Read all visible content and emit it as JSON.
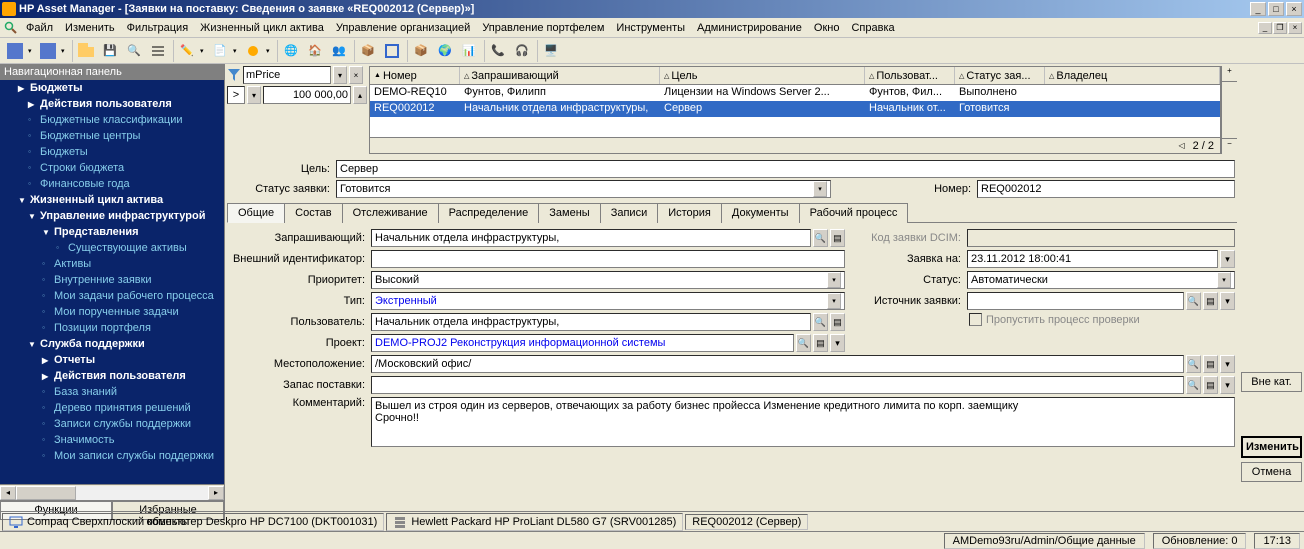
{
  "title": "HP Asset Manager - [Заявки на поставку: Сведения о заявке «REQ002012 (Сервер)»]",
  "menu": [
    "Файл",
    "Изменить",
    "Фильтрация",
    "Жизненный цикл актива",
    "Управление организацией",
    "Управление портфелем",
    "Инструменты",
    "Администрирование",
    "Окно",
    "Справка"
  ],
  "nav": {
    "header": "Навигационная панель",
    "tree": [
      {
        "l": 0,
        "t": "Бюджеты",
        "b": 1,
        "a": "▶"
      },
      {
        "l": 1,
        "t": "Действия пользователя",
        "b": 1,
        "a": "▶"
      },
      {
        "l": 1,
        "t": "Бюджетные классификации",
        "c": 1
      },
      {
        "l": 1,
        "t": "Бюджетные центры",
        "c": 1
      },
      {
        "l": 1,
        "t": "Бюджеты",
        "c": 1
      },
      {
        "l": 1,
        "t": "Строки бюджета",
        "c": 1
      },
      {
        "l": 1,
        "t": "Финансовые года",
        "c": 1
      },
      {
        "l": 0,
        "t": "Жизненный цикл актива",
        "b": 1,
        "a": "▼"
      },
      {
        "l": 1,
        "t": "Управление инфраструктурой",
        "b": 1,
        "a": "▼"
      },
      {
        "l": 2,
        "t": "Представления",
        "b": 1,
        "a": "▼"
      },
      {
        "l": 3,
        "t": "Существующие активы",
        "c": 1
      },
      {
        "l": 2,
        "t": "Активы",
        "c": 1
      },
      {
        "l": 2,
        "t": "Внутренние заявки",
        "c": 1
      },
      {
        "l": 2,
        "t": "Мои задачи рабочего процесса",
        "c": 1
      },
      {
        "l": 2,
        "t": "Мои порученные задачи",
        "c": 1
      },
      {
        "l": 2,
        "t": "Позиции портфеля",
        "c": 1
      },
      {
        "l": 1,
        "t": "Служба поддержки",
        "b": 1,
        "a": "▼"
      },
      {
        "l": 2,
        "t": "Отчеты",
        "b": 1,
        "a": "▶"
      },
      {
        "l": 2,
        "t": "Действия пользователя",
        "b": 1,
        "a": "▶"
      },
      {
        "l": 2,
        "t": "База знаний",
        "c": 1
      },
      {
        "l": 2,
        "t": "Дерево принятия решений",
        "c": 1
      },
      {
        "l": 2,
        "t": "Записи службы поддержки",
        "c": 1
      },
      {
        "l": 2,
        "t": "Значимость",
        "c": 1
      },
      {
        "l": 2,
        "t": "Мои записи службы поддержки",
        "c": 1
      }
    ],
    "tabs": [
      "Функции",
      "Избранные объекты"
    ]
  },
  "filter": {
    "field": "mPrice",
    "op": ">",
    "val": "100 000,00"
  },
  "grid": {
    "cols": [
      "Номер",
      "Запрашивающий",
      "Цель",
      "Пользоват...",
      "Статус зая...",
      "Владелец"
    ],
    "rows": [
      {
        "num": "DEMO-REQ10",
        "req": "Фунтов, Филипп",
        "goal": "Лицензии на Windows Server 2...",
        "user": "Фунтов, Фил...",
        "stat": "Выполнено",
        "own": ""
      },
      {
        "num": "REQ002012",
        "req": "Начальник отдела инфраструктуры,",
        "goal": "Сервер",
        "user": "Начальник от...",
        "stat": "Готовится",
        "own": ""
      }
    ],
    "count": "2 / 2"
  },
  "form": {
    "goal_lbl": "Цель:",
    "goal": "Сервер",
    "status_lbl": "Статус заявки:",
    "status": "Готовится",
    "number_lbl": "Номер:",
    "number": "REQ002012"
  },
  "tabs": [
    "Общие",
    "Состав",
    "Отслеживание",
    "Распределение",
    "Замены",
    "Записи",
    "История",
    "Документы",
    "Рабочий процесс"
  ],
  "detail": {
    "requester_lbl": "Запрашивающий:",
    "requester": "Начальник отдела инфраструктуры,",
    "extid_lbl": "Внешний идентификатор:",
    "extid": "",
    "priority_lbl": "Приоритет:",
    "priority": "Высокий",
    "type_lbl": "Тип:",
    "type": "Экстренный",
    "user_lbl": "Пользователь:",
    "user": "Начальник отдела инфраструктуры,",
    "project_lbl": "Проект:",
    "project": "DEMO-PROJ2 Реконструкция информационной системы",
    "location_lbl": "Местоположение:",
    "location": "/Московский офис/",
    "reserve_lbl": "Запас поставки:",
    "reserve": "",
    "comment_lbl": "Комментарий:",
    "comment": "Вышел из строя один из серверов, отвечающих за работу бизнес пройесса Изменение кредитного лимита по корп. заемщику\nСрочно!!",
    "dcim_lbl": "Код заявки DCIM:",
    "dcim": "",
    "reqon_lbl": "Заявка на:",
    "reqon": "23.11.2012 18:00:41",
    "status2_lbl": "Статус:",
    "status2": "Автоматически",
    "source_lbl": "Источник заявки:",
    "source": "",
    "skipcheck": "Пропустить процесс проверки"
  },
  "buttons": {
    "offcat": "Вне кат.",
    "modify": "Изменить",
    "cancel": "Отмена"
  },
  "statusbar": [
    "Compaq Сверхплоский компьютер Deskpro HP DC7100 (DKT001031)",
    "Hewlett Packard HP ProLiant DL580 G7 (SRV001285)",
    "REQ002012 (Сервер)"
  ],
  "footer": {
    "conn": "AMDemo93ru/Admin/Общие данные",
    "upd": "Обновление: 0",
    "time": "17:13"
  }
}
